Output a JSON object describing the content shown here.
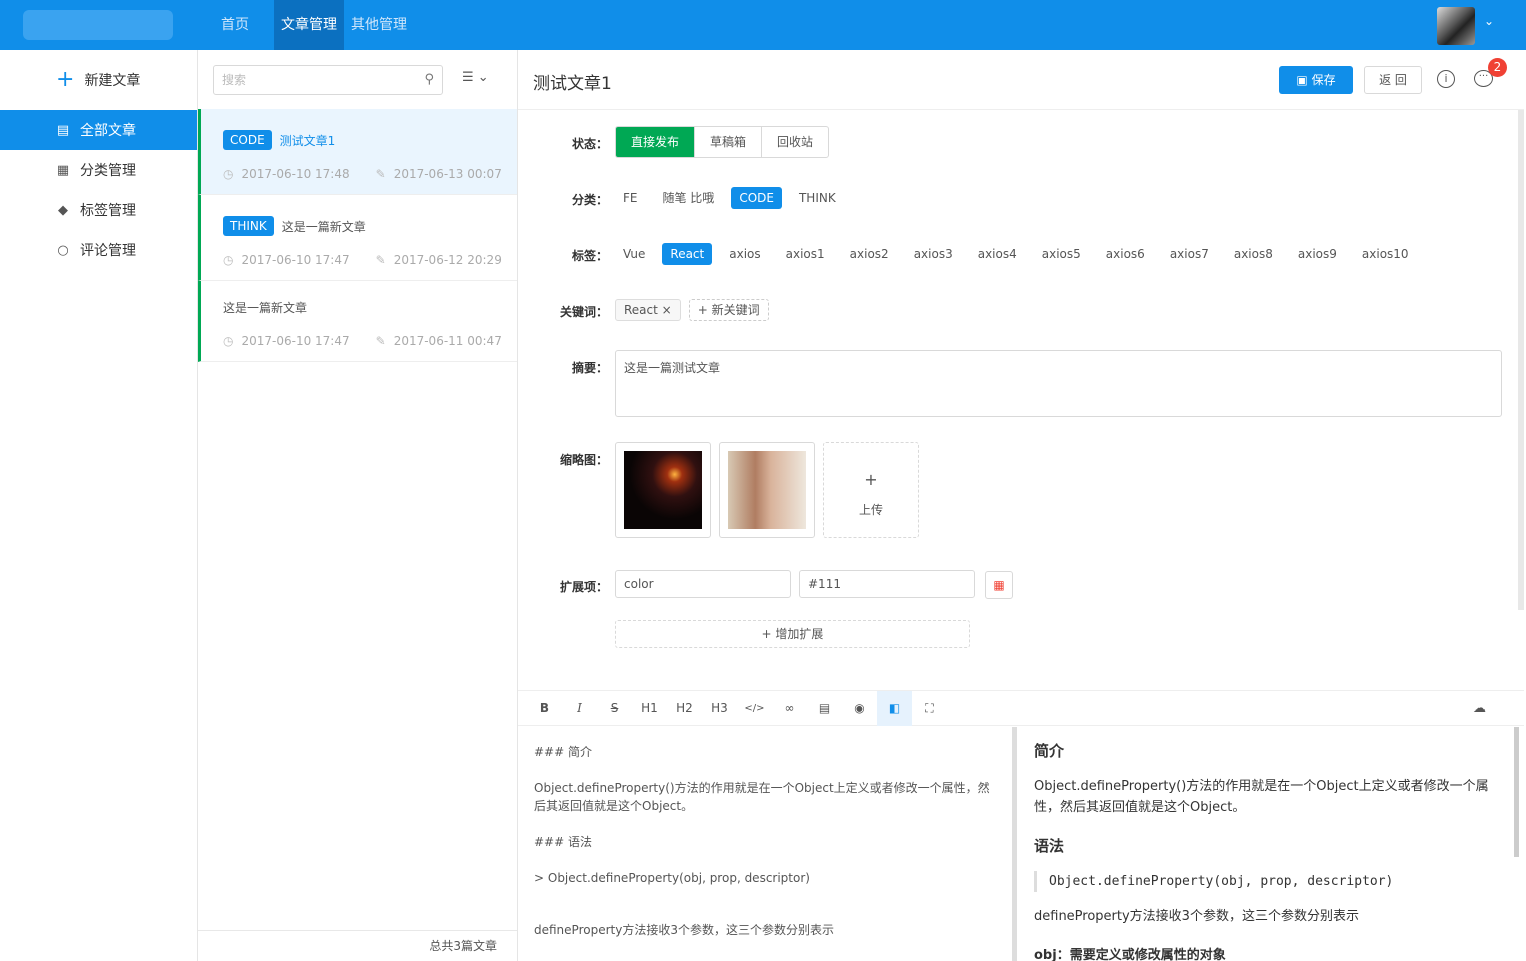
{
  "topnav": {
    "items": [
      "首页",
      "文章管理",
      "其他管理"
    ],
    "active": 1
  },
  "sidebar": {
    "new_article": "新建文章",
    "items": [
      {
        "label": "全部文章",
        "icon": "file-icon"
      },
      {
        "label": "分类管理",
        "icon": "grid-icon"
      },
      {
        "label": "标签管理",
        "icon": "tag-icon"
      },
      {
        "label": "评论管理",
        "icon": "comment-icon"
      }
    ]
  },
  "list": {
    "search_placeholder": "搜索",
    "articles": [
      {
        "tag": "CODE",
        "title": "测试文章1",
        "created": "2017-06-10 17:48",
        "updated": "2017-06-13 00:07"
      },
      {
        "tag": "THINK",
        "title": "这是一篇新文章",
        "created": "2017-06-10 17:47",
        "updated": "2017-06-12 20:29"
      },
      {
        "tag": "",
        "title": "这是一篇新文章",
        "created": "2017-06-10 17:47",
        "updated": "2017-06-11 00:47"
      }
    ],
    "footer": "总共3篇文章"
  },
  "editor": {
    "title": "测试文章1",
    "save": "保存",
    "back": "返 回",
    "info": "i",
    "badge": "2",
    "labels": {
      "status": "状态：",
      "category": "分类：",
      "tags": "标签：",
      "keywords": "关键词：",
      "summary": "摘要：",
      "thumbs": "缩略图：",
      "ext": "扩展项："
    },
    "status_options": [
      "直接发布",
      "草稿箱",
      "回收站"
    ],
    "categories": [
      "FE",
      "随笔 比哦",
      "CODE",
      "THINK"
    ],
    "tags": [
      "Vue",
      "React",
      "axios",
      "axios1",
      "axios2",
      "axios3",
      "axios4",
      "axios5",
      "axios6",
      "axios7",
      "axios8",
      "axios9",
      "axios10"
    ],
    "keyword": "React",
    "keyword_new": "+ 新关键词",
    "summary_text": "这是一篇测试文章",
    "upload": {
      "plus": "+",
      "label": "上传"
    },
    "ext": {
      "key": "color",
      "value": "#111"
    },
    "add_ext": "增加扩展"
  },
  "md": {
    "toolbar": [
      "B",
      "I",
      "S",
      "H1",
      "H2",
      "H3",
      "</>",
      "link",
      "img",
      "eye",
      "split",
      "full"
    ],
    "source": [
      "### 简介",
      "Object.defineProperty()方法的作用就是在一个Object上定义或者修改一个属性，然后其返回值就是这个Object。",
      "### 语法",
      "> Object.defineProperty(obj, prop, descriptor)",
      "defineProperty方法接收3个参数，这三个参数分别表示"
    ],
    "preview": {
      "h1": "简介",
      "p1": "Object.defineProperty()方法的作用就是在一个Object上定义或者修改一个属性，然后其返回值就是这个Object。",
      "h2": "语法",
      "quote": "Object.defineProperty(obj, prop, descriptor)",
      "p2": "defineProperty方法接收3个参数，这三个参数分别表示",
      "p3": "obj：需要定义或修改属性的对象"
    }
  },
  "colors": {
    "primary": "#108ee9",
    "green": "#00a854",
    "red": "#f04134"
  }
}
